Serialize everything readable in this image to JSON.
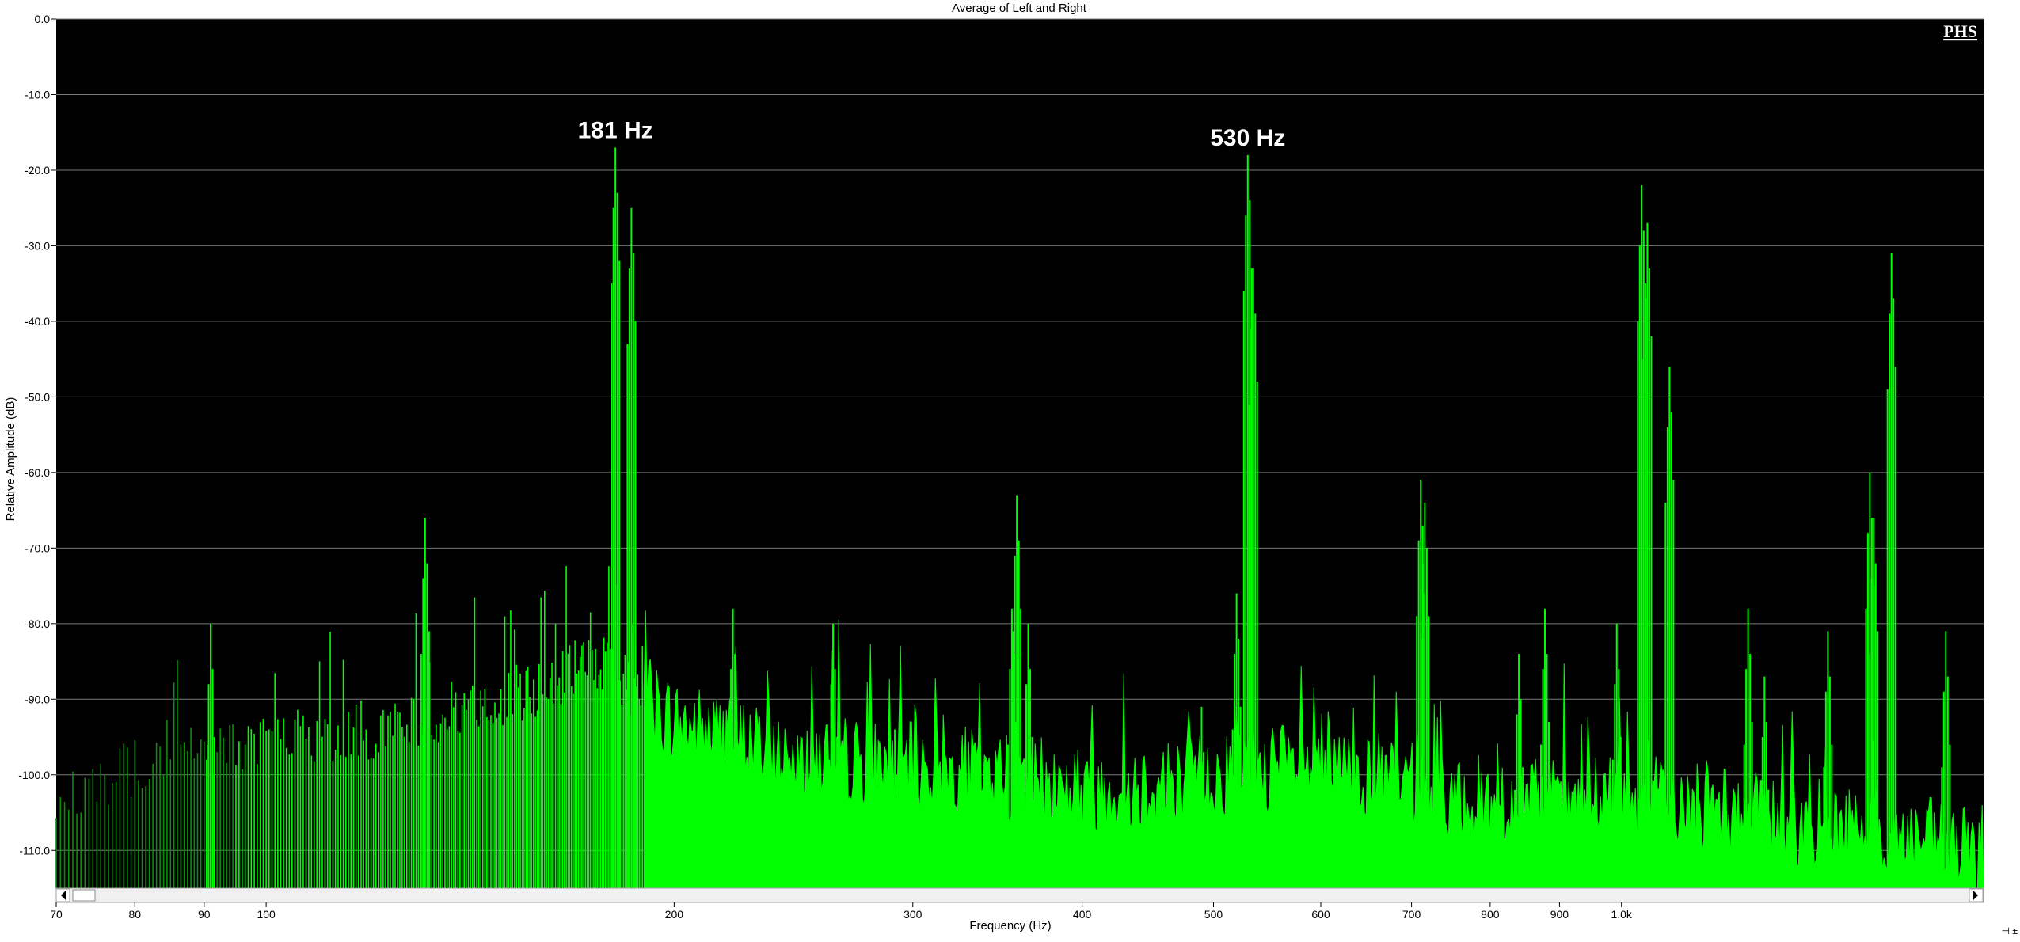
{
  "window": {
    "title": "Average of Left and Right",
    "logo": "PHS",
    "corner_glyphs": "⊣ ±"
  },
  "colors": {
    "plot_bg": "#000000",
    "grid": "#7a7a7a",
    "trace": "#00ff00",
    "trace_dark": "#0a8f0a"
  },
  "chart_data": {
    "type": "area",
    "title": "Average of Left and Right",
    "xlabel": "Frequency (Hz)",
    "ylabel": "Relative Amplitude (dB)",
    "x_scale": "log",
    "xlim": [
      70,
      1850
    ],
    "ylim": [
      -115,
      0
    ],
    "grid": true,
    "legend": "none",
    "y_ticks": [
      {
        "value": 0,
        "label": "0.0"
      },
      {
        "value": -10,
        "label": "-10.0"
      },
      {
        "value": -20,
        "label": "-20.0"
      },
      {
        "value": -30,
        "label": "-30.0"
      },
      {
        "value": -40,
        "label": "-40.0"
      },
      {
        "value": -50,
        "label": "-50.0"
      },
      {
        "value": -60,
        "label": "-60.0"
      },
      {
        "value": -70,
        "label": "-70.0"
      },
      {
        "value": -80,
        "label": "-80.0"
      },
      {
        "value": -90,
        "label": "-90.0"
      },
      {
        "value": -100,
        "label": "-100.0"
      },
      {
        "value": -110,
        "label": "-110.0"
      }
    ],
    "x_ticks": [
      {
        "value": 70,
        "label": "70"
      },
      {
        "value": 80,
        "label": "80"
      },
      {
        "value": 90,
        "label": "90"
      },
      {
        "value": 100,
        "label": "100"
      },
      {
        "value": 200,
        "label": "200"
      },
      {
        "value": 300,
        "label": "300"
      },
      {
        "value": 400,
        "label": "400"
      },
      {
        "value": 500,
        "label": "500"
      },
      {
        "value": 600,
        "label": "600"
      },
      {
        "value": 700,
        "label": "700"
      },
      {
        "value": 800,
        "label": "800"
      },
      {
        "value": 900,
        "label": "900"
      },
      {
        "value": 1000,
        "label": "1.0k"
      }
    ],
    "annotations": [
      {
        "text": "181 Hz",
        "x": 181,
        "y": -17
      },
      {
        "text": "530 Hz",
        "x": 530,
        "y": -18
      }
    ],
    "noise_floor": [
      [
        70,
        -102
      ],
      [
        80,
        -99
      ],
      [
        90,
        -97
      ],
      [
        100,
        -95
      ],
      [
        120,
        -94
      ],
      [
        150,
        -90
      ],
      [
        175,
        -85
      ],
      [
        190,
        -90
      ],
      [
        200,
        -93
      ],
      [
        240,
        -97
      ],
      [
        300,
        -99
      ],
      [
        350,
        -100
      ],
      [
        400,
        -102
      ],
      [
        450,
        -101
      ],
      [
        500,
        -100
      ],
      [
        560,
        -99
      ],
      [
        650,
        -100
      ],
      [
        750,
        -103
      ],
      [
        850,
        -104
      ],
      [
        1000,
        -103
      ],
      [
        1100,
        -104
      ],
      [
        1300,
        -106
      ],
      [
        1500,
        -107
      ],
      [
        1700,
        -109
      ],
      [
        1850,
        -111
      ]
    ],
    "peaks": [
      {
        "x": 91,
        "y": -80
      },
      {
        "x": 131,
        "y": -66
      },
      {
        "x": 181,
        "y": -17
      },
      {
        "x": 186,
        "y": -25
      },
      {
        "x": 221,
        "y": -78
      },
      {
        "x": 262,
        "y": -80
      },
      {
        "x": 291,
        "y": -94
      },
      {
        "x": 355,
        "y": -78
      },
      {
        "x": 358,
        "y": -63
      },
      {
        "x": 365,
        "y": -80
      },
      {
        "x": 490,
        "y": -91
      },
      {
        "x": 520,
        "y": -76
      },
      {
        "x": 530,
        "y": -18
      },
      {
        "x": 535,
        "y": -33
      },
      {
        "x": 711,
        "y": -61
      },
      {
        "x": 716,
        "y": -64
      },
      {
        "x": 840,
        "y": -84
      },
      {
        "x": 878,
        "y": -78
      },
      {
        "x": 992,
        "y": -80
      },
      {
        "x": 1035,
        "y": -22
      },
      {
        "x": 1045,
        "y": -27
      },
      {
        "x": 1085,
        "y": -46
      },
      {
        "x": 1240,
        "y": -78
      },
      {
        "x": 1275,
        "y": -87
      },
      {
        "x": 1420,
        "y": -81
      },
      {
        "x": 1525,
        "y": -60
      },
      {
        "x": 1535,
        "y": -66
      },
      {
        "x": 1582,
        "y": -31
      },
      {
        "x": 1735,
        "y": -81
      }
    ]
  }
}
